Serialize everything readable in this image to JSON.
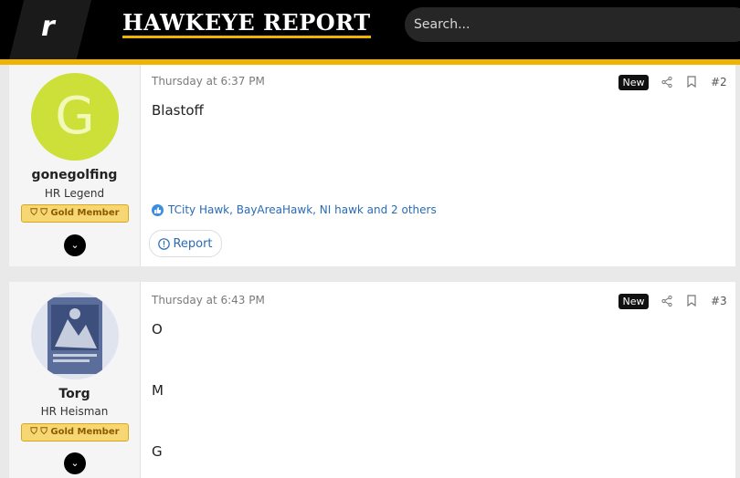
{
  "header": {
    "rivals_logo": "r",
    "site_logo": "HAWKEYE REPORT",
    "search_placeholder": "Search..."
  },
  "colors": {
    "accent": "#f0b400",
    "link": "#2a6bb5",
    "avatar_bg": "#cde03a"
  },
  "posts": [
    {
      "user": {
        "avatar_letter": "G",
        "name": "gonegolfing",
        "title": "HR Legend",
        "badge": "⛉ ⛉ Gold Member"
      },
      "time": "Thursday at 6:37 PM",
      "new_label": "New",
      "number": "#2",
      "body": [
        "Blastoff"
      ],
      "reactions": "TCity Hawk, BayAreaHawk, NI hawk and 2 others",
      "report_label": "Report"
    },
    {
      "user": {
        "avatar_icon": "avatar-image",
        "name": "Torg",
        "title": "HR Heisman",
        "badge": "⛉ ⛉ Gold Member"
      },
      "time": "Thursday at 6:43 PM",
      "new_label": "New",
      "number": "#3",
      "body": [
        "O",
        "M",
        "G"
      ]
    }
  ]
}
